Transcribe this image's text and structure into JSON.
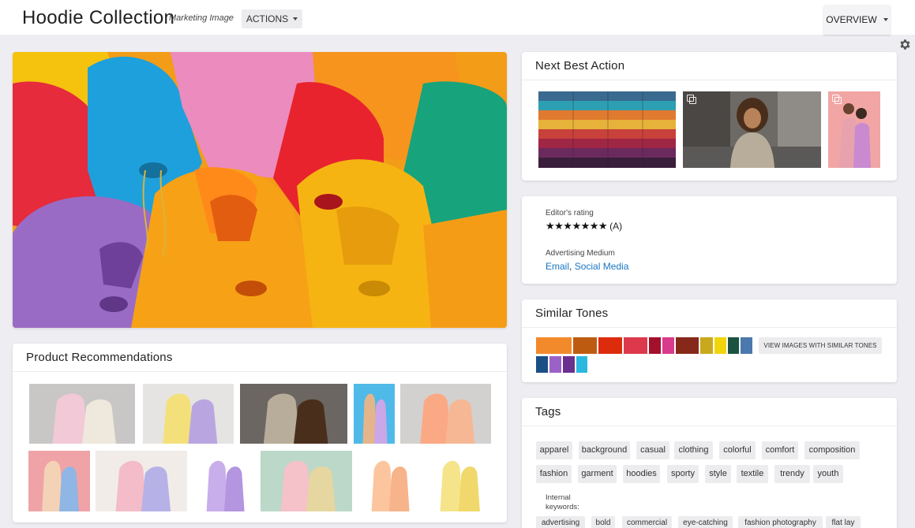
{
  "header": {
    "title": "Hoodie Collection",
    "subtitle": "Marketing Image",
    "actions_label": "ACTIONS",
    "overview_label": "OVERVIEW"
  },
  "next_best_action": {
    "title": "Next Best Action"
  },
  "details": {
    "rating_label": "Editor's rating",
    "rating_stars": "★★★★★★★",
    "rating_grade": "(A)",
    "medium_label": "Advertising Medium",
    "medium_values": [
      "Email",
      "Social Media"
    ]
  },
  "similar_tones": {
    "title": "Similar Tones",
    "button_label": "VIEW IMAGES WITH SIMILAR TONES",
    "colors": [
      "#f28a2c",
      "#bd5c11",
      "#dc2c0c",
      "#dc3a4c",
      "#a3102c",
      "#d83a8c",
      "#86281a",
      "#c9a81e",
      "#f0d50c",
      "#1b5240",
      "#4b78ae",
      "#1a4f86",
      "#9a62c6",
      "#6a3090",
      "#2bb8e0"
    ]
  },
  "product_recommendations": {
    "title": "Product Recommendations"
  },
  "tags": {
    "title": "Tags",
    "items": [
      "apparel",
      "background",
      "casual",
      "clothing",
      "colorful",
      "comfort",
      "composition",
      "fashion",
      "garment",
      "hoodies",
      "sporty",
      "style",
      "textile",
      "trendy",
      "youth"
    ],
    "internal_label": "Internal keywords:",
    "internal_items": [
      "advertising",
      "bold",
      "commercial",
      "eye-catching",
      "fashion photography",
      "flat lay"
    ]
  }
}
